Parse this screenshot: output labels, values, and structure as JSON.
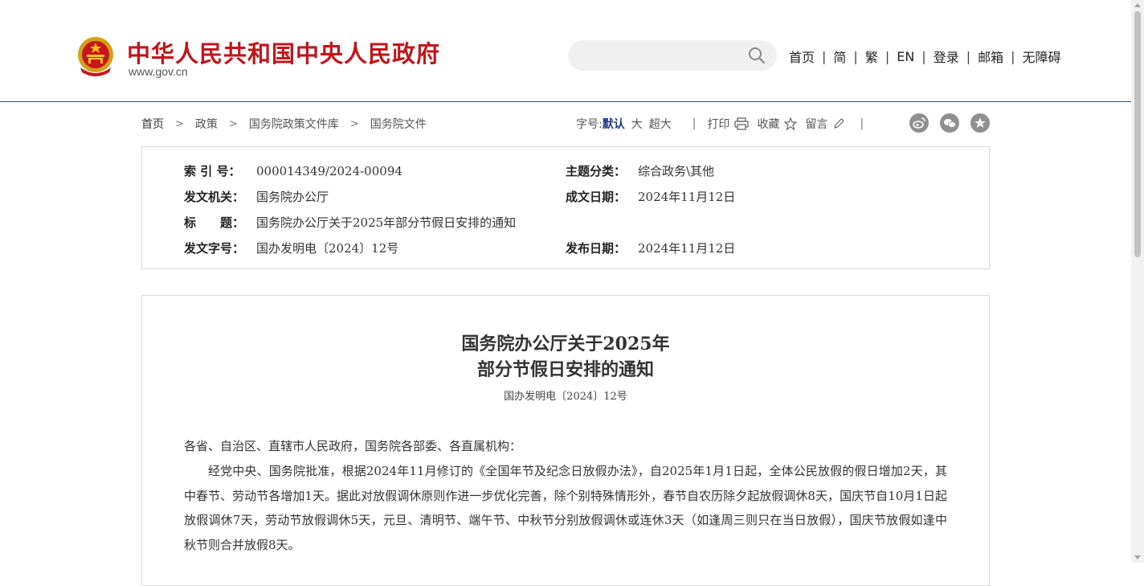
{
  "header": {
    "site_title": "中华人民共和国中央人民政府",
    "site_url": "www.gov.cn",
    "search": {
      "placeholder": "",
      "icon": "search-icon"
    },
    "nav": [
      "首页",
      "简",
      "繁",
      "EN",
      "登录",
      "邮箱",
      "无障碍"
    ]
  },
  "breadcrumb": [
    "首页",
    "政策",
    "国务院政策文件库",
    "国务院文件"
  ],
  "toolbar": {
    "font_label": "字号:",
    "font_default": "默认",
    "font_large": "大",
    "font_xlarge": "超大",
    "print": "打印",
    "favorite": "收藏",
    "comment": "留言",
    "share_icons": [
      "weibo-icon",
      "wechat-icon",
      "star-icon"
    ]
  },
  "meta": {
    "index_label": "索 引 号：",
    "index_value": "000014349/2024-00094",
    "category_label": "主题分类：",
    "category_value": "综合政务\\其他",
    "issuer_label": "发文机关：",
    "issuer_value": "国务院办公厅",
    "date_written_label": "成文日期：",
    "date_written_value": "2024年11月12日",
    "title_label": "标　　题：",
    "title_value": "国务院办公厅关于2025年部分节假日安排的通知",
    "doc_no_label": "发文字号：",
    "doc_no_value": "国办发明电〔2024〕12号",
    "publish_label": "发布日期：",
    "publish_value": "2024年11月12日"
  },
  "document": {
    "title_line1": "国务院办公厅关于2025年",
    "title_line2": "部分节假日安排的通知",
    "doc_number": "国办发明电〔2024〕12号",
    "salutation": "各省、自治区、直辖市人民政府，国务院各部委、各直属机构：",
    "paragraph1": "经党中央、国务院批准，根据2024年11月修订的《全国年节及纪念日放假办法》，自2025年1月1日起，全体公民放假的假日增加2天，其中春节、劳动节各增加1天。据此对放假调休原则作进一步优化完善，除个别特殊情形外，春节自农历除夕起放假调休8天，国庆节自10月1日起放假调休7天，劳动节放假调休5天，元旦、清明节、端午节、中秋节分别放假调休或连休3天（如逢周三则只在当日放假），国庆节放假如逢中秋节则合并放假8天。"
  },
  "colors": {
    "brand_red": "#c0161c",
    "active_blue": "#1f3c88",
    "header_rule": "#2e4a6b"
  }
}
